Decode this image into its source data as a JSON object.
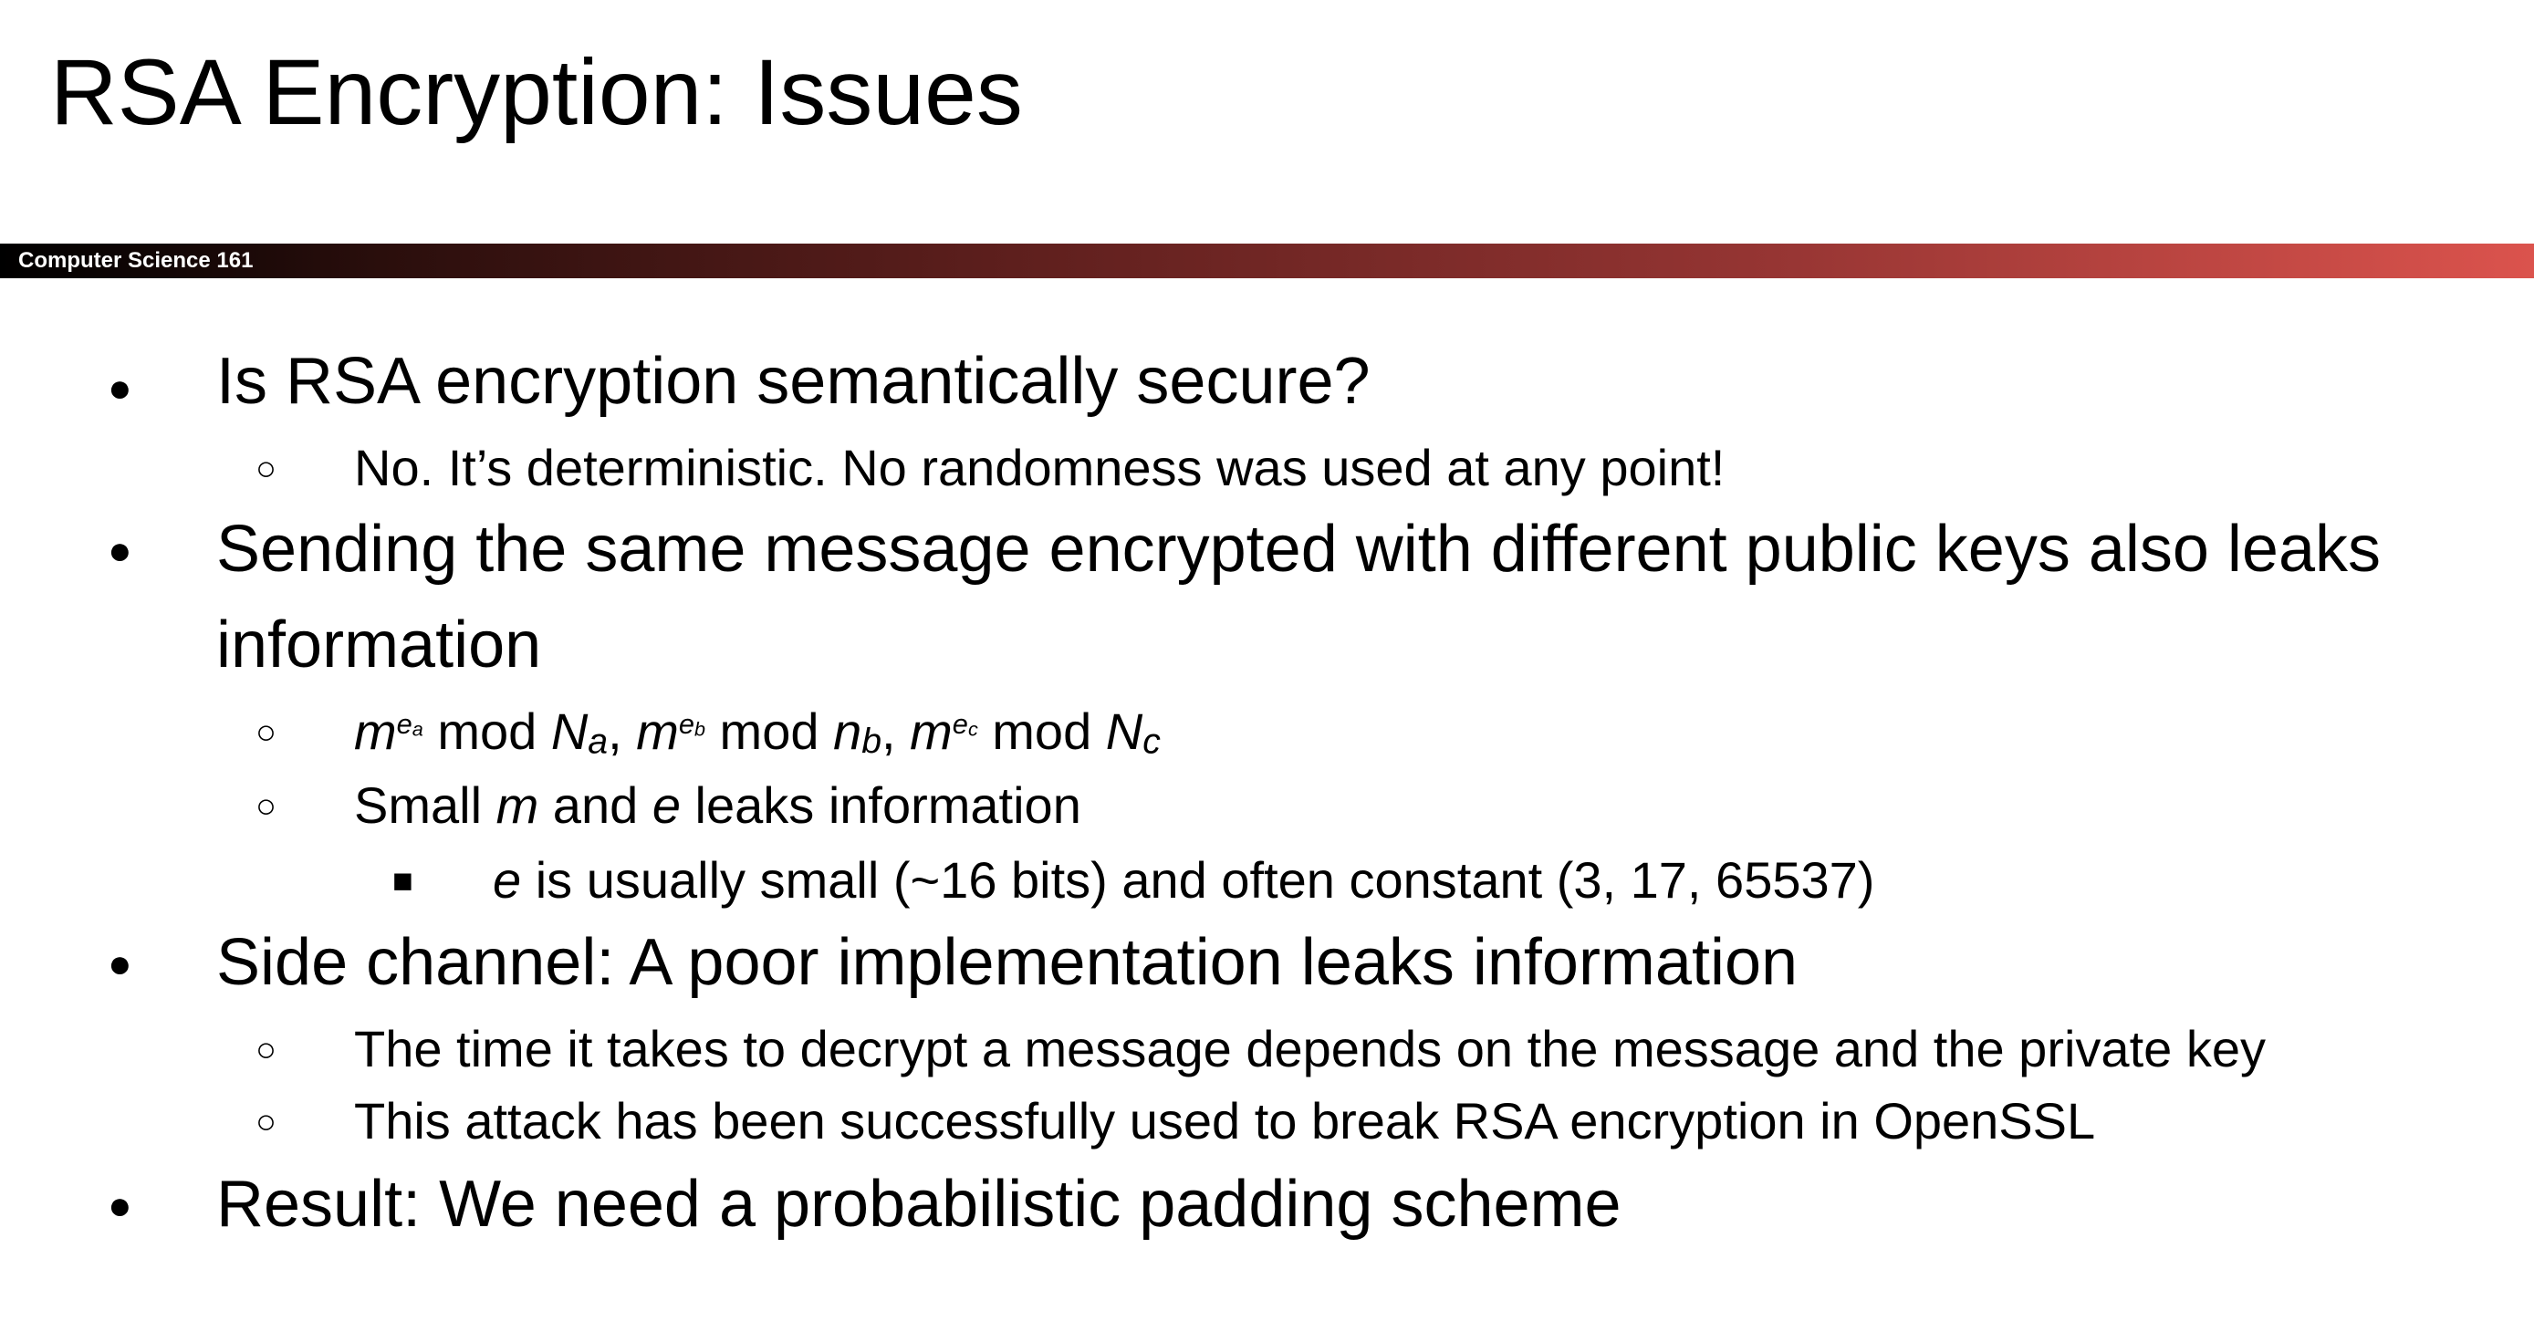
{
  "title": "RSA Encryption: Issues",
  "course": "Computer Science 161",
  "glyphs": {
    "bullet_l1": "●",
    "bullet_l2": "○",
    "bullet_l3": "■"
  },
  "bullets": {
    "b1": "Is RSA encryption semantically secure?",
    "b1_1": "No. It’s deterministic. No randomness was used at any point!",
    "b2_line1": "Sending the same message encrypted with different public keys also leaks",
    "b2_line2": "information",
    "b2_1": {
      "m": "m",
      "ea_base": "e",
      "ea_sub": "a",
      "mod": " mod ",
      "N": "N",
      "a": "a",
      "comma": ", ",
      "eb_base": "e",
      "eb_sub": "b",
      "n": "n",
      "b": "b",
      "ec_base": "e",
      "ec_sub": "c",
      "c": "c"
    },
    "b2_2": {
      "t1": "Small ",
      "m": "m",
      "t2": " and ",
      "e": "e",
      "t3": " leaks information"
    },
    "b2_2_1": {
      "e": "e",
      "rest": " is usually small (~16 bits) and often constant (3, 17, 65537)"
    },
    "b3": "Side channel: A poor implementation leaks information",
    "b3_1": "The time it takes to decrypt a message depends on the message and the private key",
    "b3_2": "This attack has been successfully used to break RSA encryption in OpenSSL",
    "b4": "Result: We need a probabilistic padding scheme"
  }
}
